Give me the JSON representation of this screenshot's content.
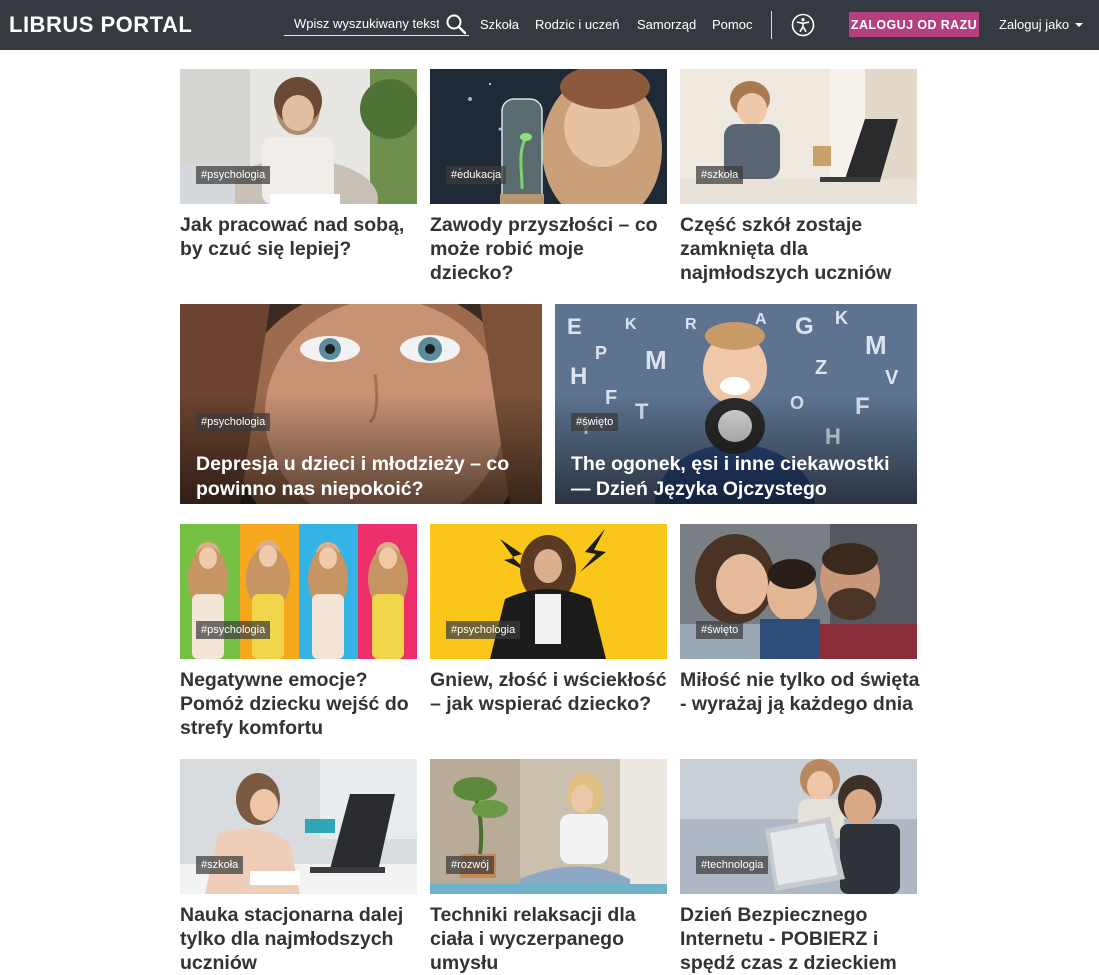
{
  "navbar": {
    "brand": "LIBRUS PORTAL",
    "search_placeholder": "Wpisz wyszukiwany tekst",
    "links": [
      "Szkoła",
      "Rodzic i uczeń",
      "Samorząd",
      "Pomoc"
    ],
    "login_button": "ZALOGUJ OD RAZU",
    "login_as": "Zaloguj jako",
    "accent_color": "#b5407f",
    "background_color": "#343a40"
  },
  "articles": [
    {
      "tag": "#psychologia",
      "title": "Jak pracować nad sobą, by czuć się lepiej?"
    },
    {
      "tag": "#edukacja",
      "title": "Zawody przyszłości – co może robić moje dziecko?"
    },
    {
      "tag": "#szkoła",
      "title": "Część szkół zostaje zamknięta dla najmłodszych uczniów"
    },
    {
      "tag": "#psychologia",
      "title": "Depresja u dzieci i młodzieży – co powinno nas niepokoić?"
    },
    {
      "tag": "#święto",
      "title": "The ogonek, ęsi i inne ciekawostki — Dzień Języka Ojczystego"
    },
    {
      "tag": "#psychologia",
      "title": "Negatywne emocje? Pomóż dziecku wejść do strefy komfortu"
    },
    {
      "tag": "#psychologia",
      "title": "Gniew, złość i wściekłość – jak wspierać dziecko?"
    },
    {
      "tag": "#święto",
      "title": "Miłość nie tylko od święta - wyrażaj ją każdego dnia"
    },
    {
      "tag": "#szkoła",
      "title": "Nauka stacjonarna dalej tylko dla najmłodszych uczniów"
    },
    {
      "tag": "#rozwój",
      "title": "Techniki relaksacji dla ciała i wyczerpanego umysłu"
    },
    {
      "tag": "#technologia",
      "title": "Dzień Bezpiecznego Internetu - POBIERZ i spędź czas z dzieckiem"
    }
  ]
}
